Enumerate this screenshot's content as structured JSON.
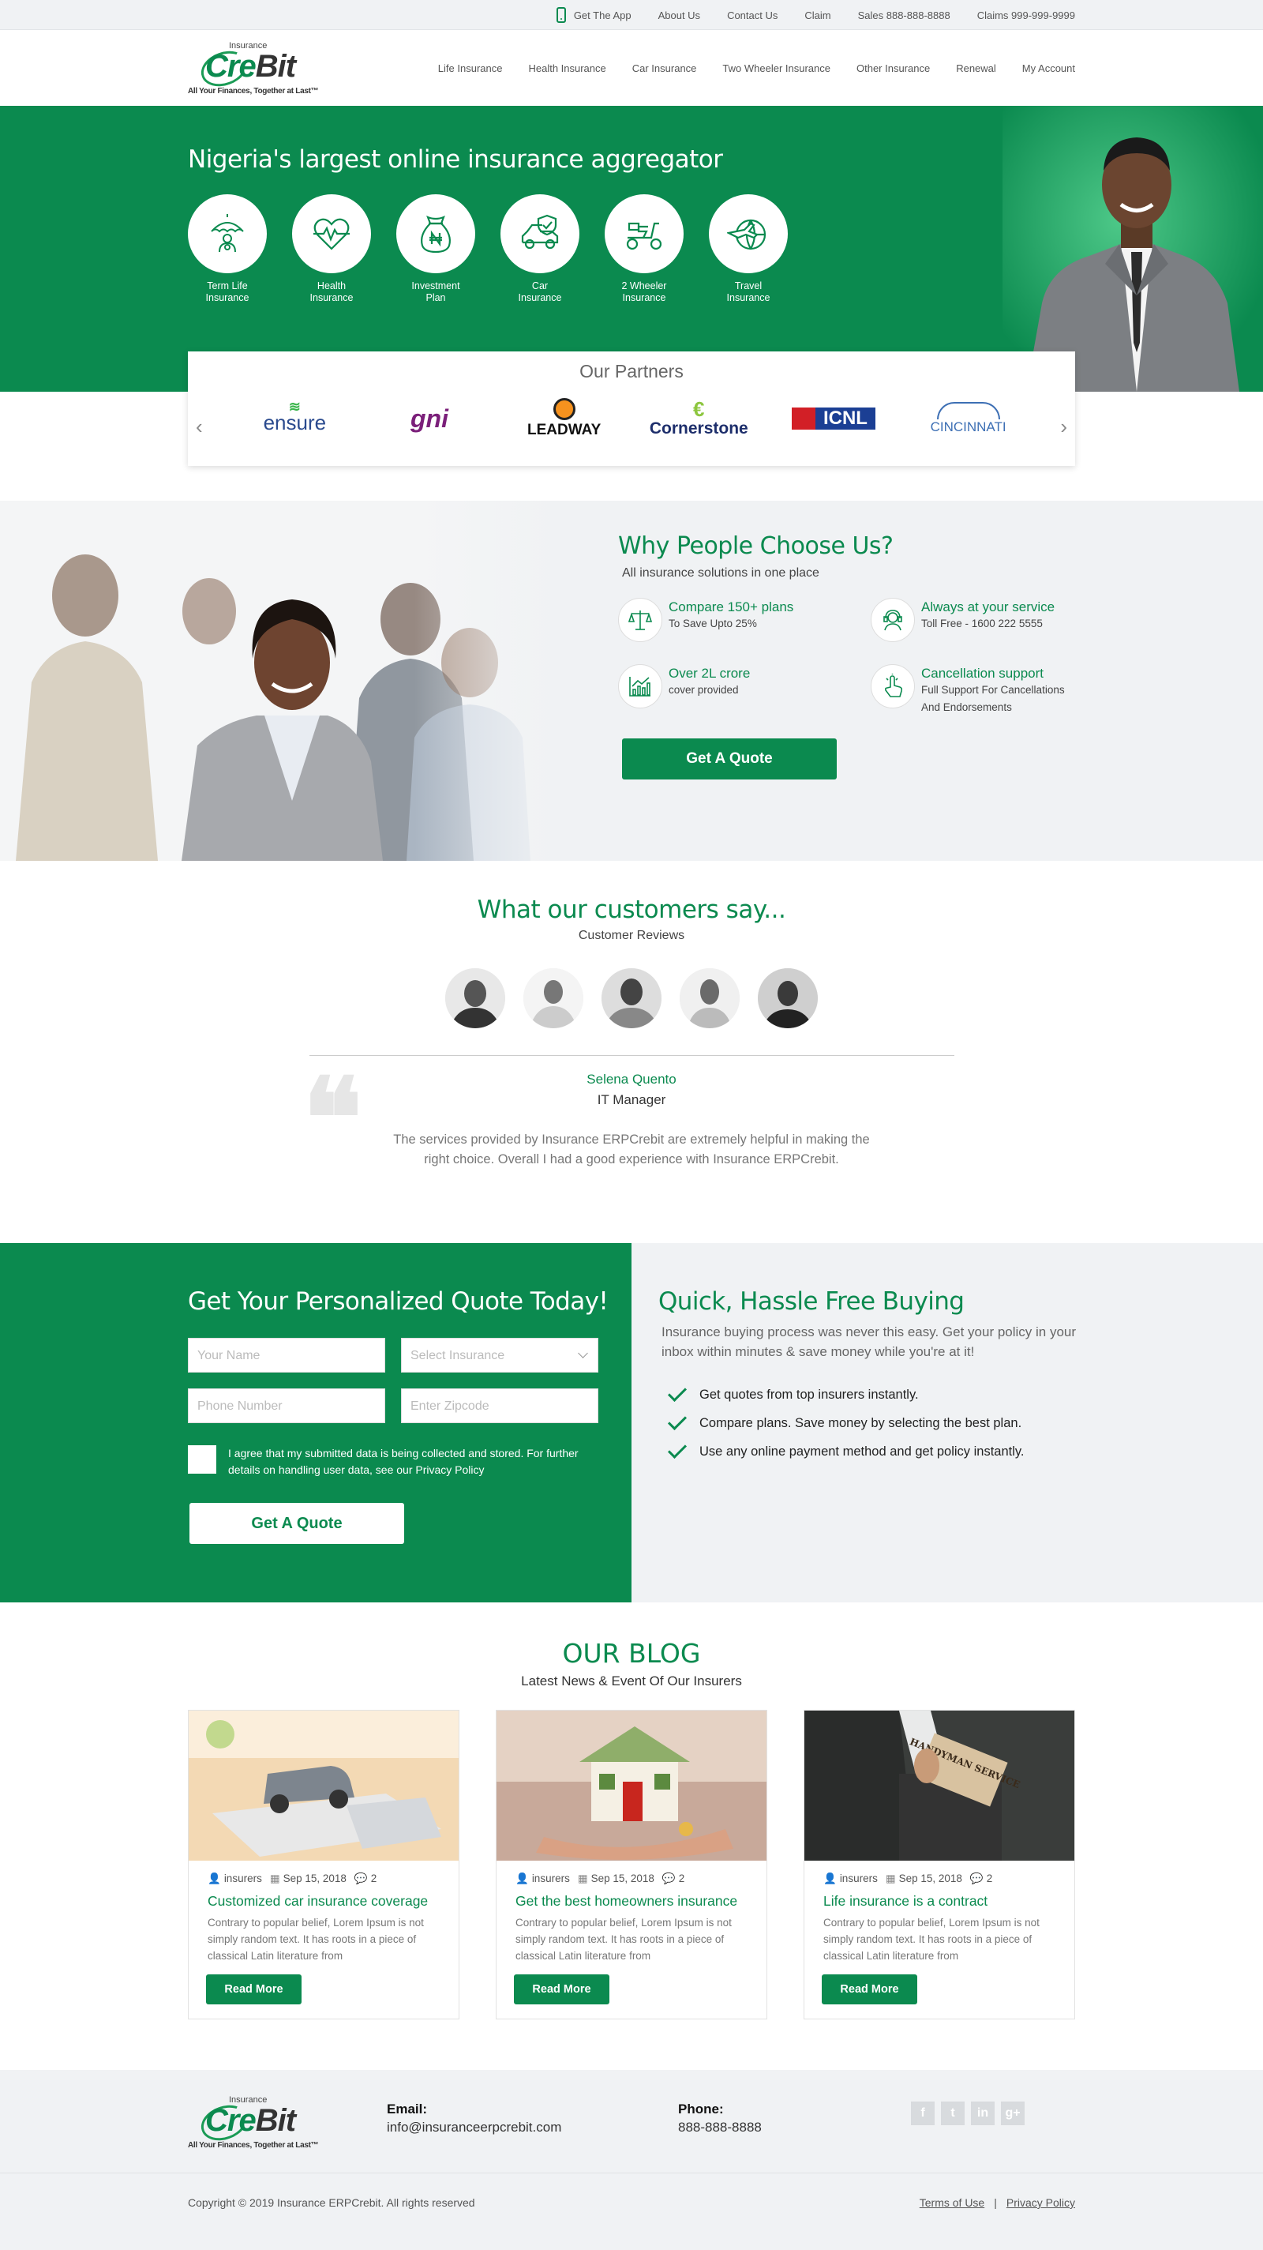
{
  "topbar": {
    "get_app": "Get The App",
    "about": "About Us",
    "contact": "Contact Us",
    "claim": "Claim",
    "sales": "Sales 888-888-8888",
    "claims": "Claims 999-999-9999"
  },
  "logo": {
    "small": "Insurance",
    "name_green": "Cre",
    "name_dark": "Bit",
    "tagline": "All Your Finances, Together at Last™"
  },
  "nav": [
    "Life Insurance",
    "Health Insurance",
    "Car Insurance",
    "Two Wheeler Insurance",
    "Other Insurance",
    "Renewal",
    "My Account"
  ],
  "hero": {
    "title": "Nigeria's largest online insurance aggregator",
    "categories": [
      {
        "label_1": "Term Life",
        "label_2": "Insurance",
        "icon": "umbrella-family-icon"
      },
      {
        "label_1": "Health",
        "label_2": "Insurance",
        "icon": "heart-pulse-icon"
      },
      {
        "label_1": "Investment",
        "label_2": "Plan",
        "icon": "money-bag-icon"
      },
      {
        "label_1": "Car",
        "label_2": "Insurance",
        "icon": "car-shield-icon"
      },
      {
        "label_1": "2 Wheeler",
        "label_2": "Insurance",
        "icon": "scooter-icon"
      },
      {
        "label_1": "Travel",
        "label_2": "Insurance",
        "icon": "plane-globe-icon"
      }
    ]
  },
  "partners": {
    "title": "Our Partners",
    "logos": [
      "ensure",
      "gni",
      "LEADWAY",
      "Cornerstone",
      "ICNL",
      "CINCINNATI"
    ]
  },
  "why": {
    "title": "Why People Choose Us?",
    "subtitle": "All insurance solutions in one place",
    "features": [
      {
        "title": "Compare 150+ plans",
        "desc_1": "To Save Upto 25%",
        "desc_2": "",
        "icon": "scales-icon"
      },
      {
        "title": "Always at your service",
        "desc_1": "Toll Free - 1600 222 5555",
        "desc_2": "",
        "icon": "headset-icon"
      },
      {
        "title": "Over 2L crore",
        "desc_1": "cover provided",
        "desc_2": "",
        "icon": "growth-chart-icon"
      },
      {
        "title": "Cancellation support",
        "desc_1": "Full Support For Cancellations",
        "desc_2": "And Endorsements",
        "icon": "hand-click-icon"
      }
    ],
    "button": "Get A Quote"
  },
  "testimonials": {
    "title": "What our customers say...",
    "subtitle": "Customer Reviews",
    "name": "Selena Quento",
    "role": "IT Manager",
    "text": "The services provided by Insurance ERPCrebit are extremely helpful in making the right choice. Overall I had a good experience with Insurance ERPCrebit."
  },
  "quote_form": {
    "title": "Get Your Personalized Quote Today!",
    "name_placeholder": "Your Name",
    "insurance_placeholder": "Select Insurance",
    "phone_placeholder": "Phone Number",
    "zip_placeholder": "Enter Zipcode",
    "agree": "I agree that my submitted data is being collected and stored. For further details on handling user data, see our Privacy Policy",
    "button": "Get A Quote"
  },
  "buying": {
    "title": "Quick, Hassle Free Buying",
    "desc": "Insurance buying process was never this easy. Get your policy in your inbox within minutes & save money while you're at it!",
    "points": [
      "Get quotes from top insurers instantly.",
      "Compare plans. Save money by selecting the best plan.",
      "Use any online payment method and get policy instantly."
    ]
  },
  "blog": {
    "title": "OUR BLOG",
    "subtitle": "Latest News & Event Of  Our Insurers",
    "posts": [
      {
        "author": "insurers",
        "date": "Sep 15, 2018",
        "comments": "2",
        "title": "Customized car insurance coverage",
        "text": "Contrary to popular belief, Lorem Ipsum is not simply random text. It has roots in a piece of classical Latin literature from",
        "button": "Read More"
      },
      {
        "author": "insurers",
        "date": "Sep 15, 2018",
        "comments": "2",
        "title": "Get the best homeowners insurance",
        "text": "Contrary to popular belief, Lorem Ipsum is not simply random text. It has roots in a piece of classical Latin literature from",
        "button": "Read More"
      },
      {
        "author": "insurers",
        "date": "Sep 15, 2018",
        "comments": "2",
        "title": "Life insurance is a contract",
        "text": "Contrary to popular belief, Lorem Ipsum is not simply random text. It has roots in a piece of classical Latin literature from",
        "button": "Read More"
      }
    ],
    "handyman_sign": "HANDYMAN SERVICE"
  },
  "footer": {
    "email_label": "Email:",
    "email": "info@insuranceerpcrebit.com",
    "phone_label": "Phone:",
    "phone": "888-888-8888",
    "social": [
      "f",
      "t",
      "in",
      "g+"
    ],
    "copyright": "Copyright © 2019 Insurance ERPCrebit. All rights reserved",
    "terms": "Terms of Use",
    "privacy": "Privacy Policy",
    "separator": "|"
  },
  "colors": {
    "brand_green": "#0b8a4f",
    "light_bg": "#f0f2f4"
  }
}
